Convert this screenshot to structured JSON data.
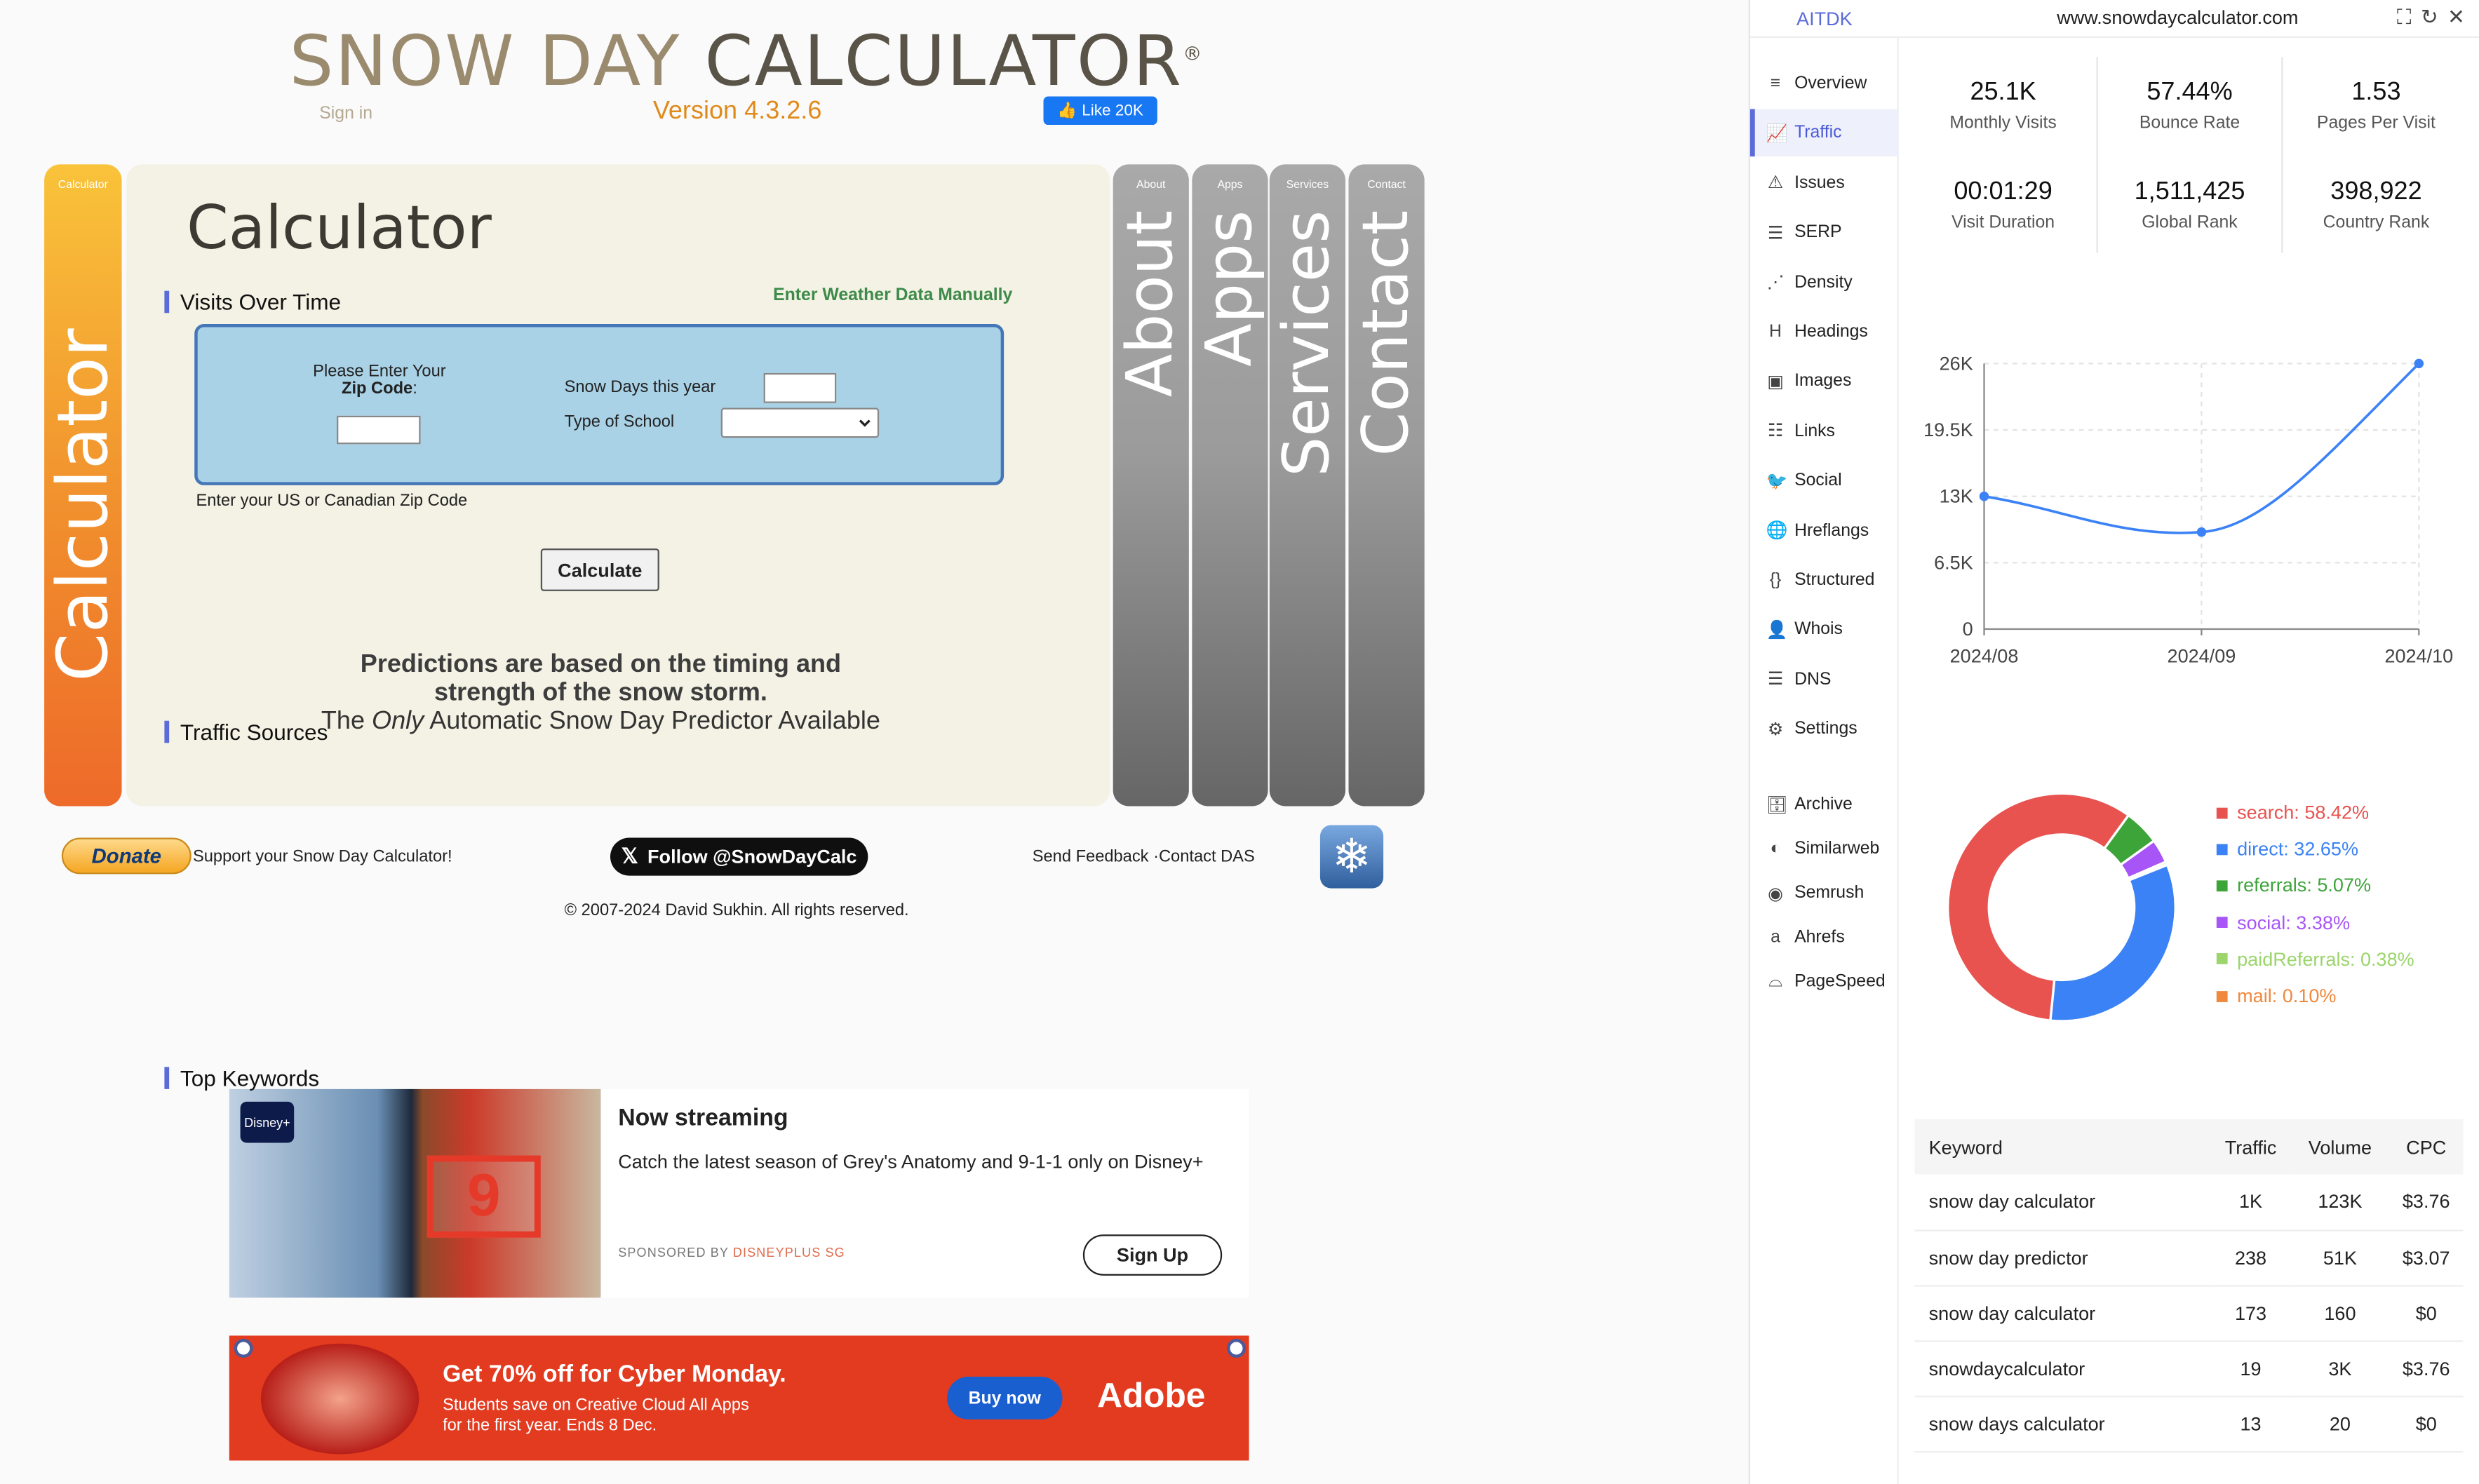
{
  "header": {
    "logo_light": "SNOW DAY ",
    "logo_dark": "CALCULATOR",
    "logo_reg": "®",
    "signin": "Sign in",
    "version": "Version 4.3.2.6",
    "like": "Like 20K"
  },
  "calc": {
    "tab_small": "Calculator",
    "tab_big": "Calculator",
    "title": "Calculator",
    "manual_link": "Enter Weather Data Manually",
    "zip_label_1": "Please Enter Your",
    "zip_label_2": "Zip Code",
    "zip_colon": ":",
    "snow_days_label": "Snow Days this year",
    "school_label": "Type of School",
    "zip_note": "Enter your US or Canadian Zip Code",
    "button": "Calculate",
    "pred_line1": "Predictions are based on the timing and",
    "pred_line2": "strength of the snow storm.",
    "pred_the": "The ",
    "pred_only": "Only",
    "pred_rest": " Automatic Snow Day Predictor Available"
  },
  "tabs": [
    {
      "small": "About",
      "big": "About"
    },
    {
      "small": "Apps",
      "big": "Apps"
    },
    {
      "small": "Services",
      "big": "Services"
    },
    {
      "small": "Contact",
      "big": "Contact"
    }
  ],
  "footer": {
    "donate": "Donate",
    "support": "Support your Snow Day Calculator!",
    "follow": "Follow @SnowDayCalc",
    "feedback": "Send Feedback ·Contact DAS",
    "copyright": "© 2007-2024 David Sukhin. All rights reserved."
  },
  "ad1": {
    "badge": "Disney+",
    "title": "Now streaming",
    "text": "Catch the latest season of Grey's Anatomy and 9-1-1 only on Disney+",
    "sponsor_prefix": "SPONSORED BY ",
    "sponsor": "DISNEYPLUS SG",
    "button": "Sign Up"
  },
  "ad2": {
    "title": "Get 70% off for Cyber Monday.",
    "text": "Students save on Creative Cloud All Apps for the first year. Ends 8 Dec.",
    "button": "Buy now",
    "brand": "Adobe"
  },
  "ext": {
    "brand": "AITDK",
    "url": "www.snowdaycalculator.com",
    "nav": [
      "Overview",
      "Traffic",
      "Issues",
      "SERP",
      "Density",
      "Headings",
      "Images",
      "Links",
      "Social",
      "Hreflangs",
      "Structured",
      "Whois",
      "DNS",
      "Settings"
    ],
    "nav2": [
      "Archive",
      "Similarweb",
      "Semrush",
      "Ahrefs",
      "PageSpeed"
    ],
    "stats": [
      {
        "v": "25.1K",
        "l": "Monthly Visits"
      },
      {
        "v": "57.44%",
        "l": "Bounce Rate"
      },
      {
        "v": "1.53",
        "l": "Pages Per Visit"
      },
      {
        "v": "00:01:29",
        "l": "Visit Duration"
      },
      {
        "v": "1,511,425",
        "l": "Global Rank"
      },
      {
        "v": "398,922",
        "l": "Country Rank"
      }
    ],
    "visits_title": "Visits Over Time",
    "sources_title": "Traffic Sources",
    "keywords_title": "Top Keywords",
    "sources": [
      {
        "label": "search: 58.42%",
        "color": "#e8524f"
      },
      {
        "label": "direct: 32.65%",
        "color": "#3b82f6"
      },
      {
        "label": "referrals: 5.07%",
        "color": "#3da43a"
      },
      {
        "label": "social: 3.38%",
        "color": "#a855f7"
      },
      {
        "label": "paidReferrals: 0.38%",
        "color": "#9bd56b"
      },
      {
        "label": "mail: 0.10%",
        "color": "#f0883e"
      }
    ],
    "kw_head": [
      "Keyword",
      "Traffic",
      "Volume",
      "CPC"
    ],
    "keywords": [
      [
        "snow day calculator",
        "1K",
        "123K",
        "$3.76"
      ],
      [
        "snow day predictor",
        "238",
        "51K",
        "$3.07"
      ],
      [
        "snow day calculator",
        "173",
        "160",
        "$0"
      ],
      [
        "snowdaycalculator",
        "19",
        "3K",
        "$3.76"
      ],
      [
        "snow days calculator",
        "13",
        "20",
        "$0"
      ]
    ]
  },
  "chart_data": [
    {
      "type": "line",
      "title": "Visits Over Time",
      "x": [
        "2024/08",
        "2024/09",
        "2024/10"
      ],
      "series": [
        {
          "values": [
            13000,
            9500,
            26000
          ]
        }
      ],
      "ylim": [
        0,
        26000
      ],
      "yticks": [
        "0",
        "6.5K",
        "13K",
        "19.5K",
        "26K"
      ],
      "grid": true
    },
    {
      "type": "pie",
      "title": "Traffic Sources",
      "categories": [
        "search",
        "direct",
        "referrals",
        "social",
        "paidReferrals",
        "mail"
      ],
      "values": [
        58.42,
        32.65,
        5.07,
        3.38,
        0.38,
        0.1
      ],
      "colors": [
        "#e8524f",
        "#3b82f6",
        "#3da43a",
        "#a855f7",
        "#9bd56b",
        "#f0883e"
      ],
      "legend": "right"
    }
  ]
}
